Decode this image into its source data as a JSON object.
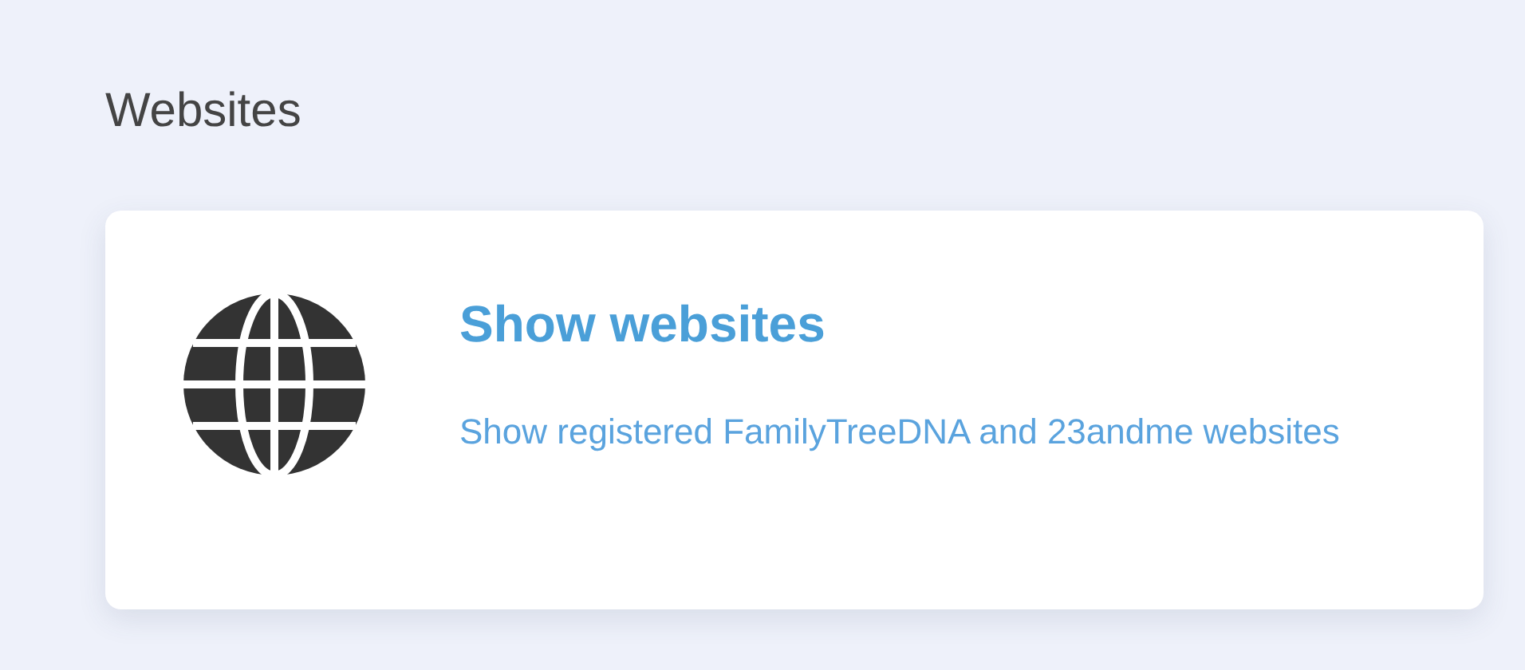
{
  "section": {
    "title": "Websites"
  },
  "card": {
    "title": "Show websites",
    "description": "Show registered FamilyTreeDNA and 23andme websites"
  }
}
